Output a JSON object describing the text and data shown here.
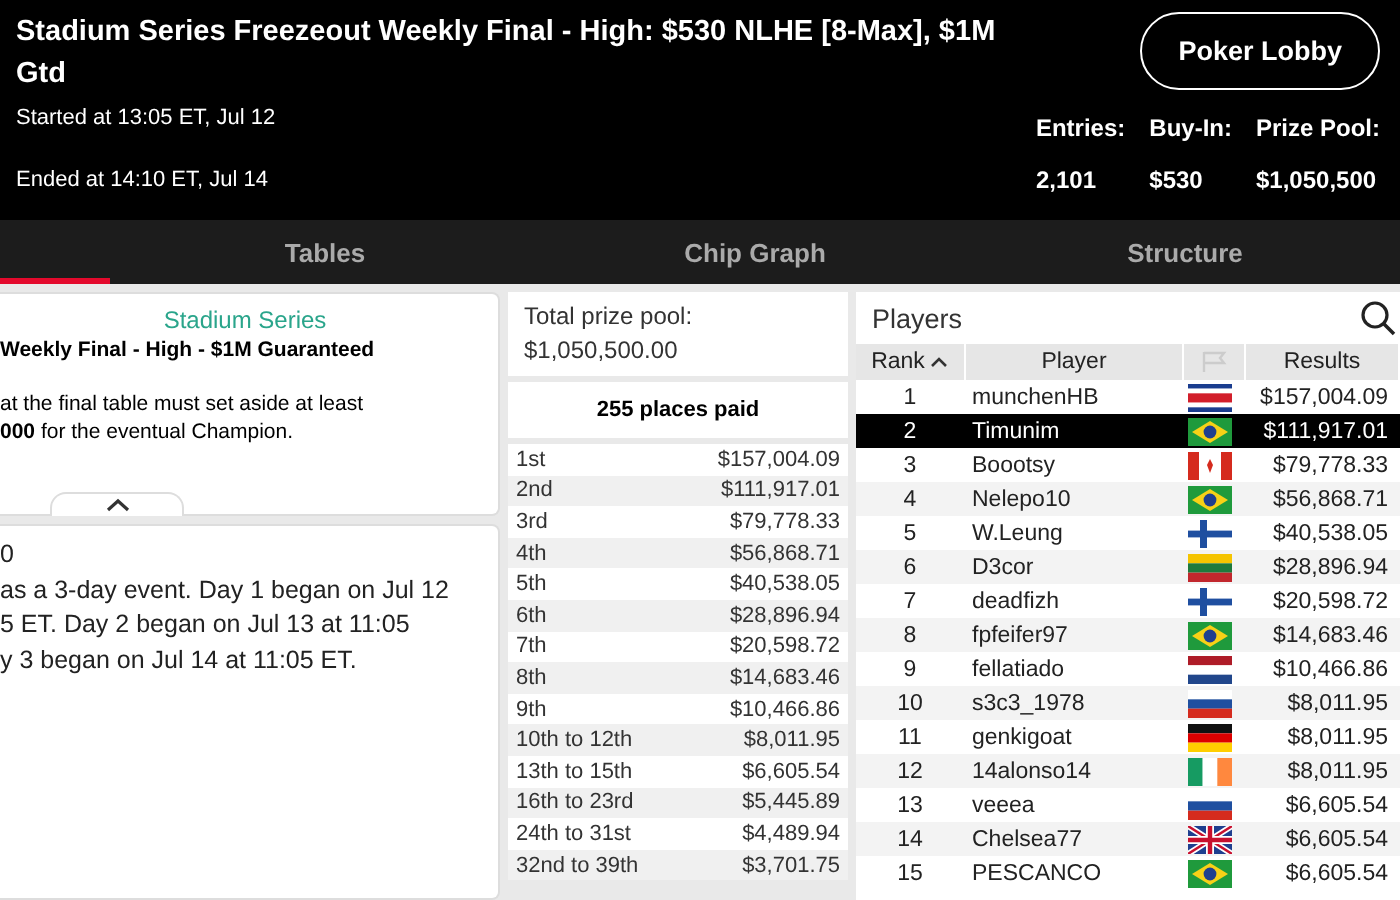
{
  "header": {
    "title": "Stadium Series Freezeout Weekly Final - High: $530 NLHE [8-Max], $1M Gtd",
    "started": "Started at 13:05 ET, Jul 12",
    "ended": "Ended at 14:10 ET, Jul 14",
    "lobby_button": "Poker Lobby",
    "stats": [
      {
        "label": "Entries:",
        "value": "2,101"
      },
      {
        "label": "Buy-In:",
        "value": "$530"
      },
      {
        "label": "Prize Pool:",
        "value": "$1,050,500"
      }
    ]
  },
  "tabs": [
    {
      "selected": true
    },
    {
      "label": "Tables",
      "selected": false
    },
    {
      "label": "Chip Graph",
      "selected": false
    },
    {
      "label": "Structure",
      "selected": false
    }
  ],
  "info_card": {
    "brand": "Stadium Series",
    "subtitle": "Weekly Final - High - $1M Guaranteed",
    "text": "at the final table must set aside at least\n**000** for the eventual Champion."
  },
  "details_card": {
    "lines": [
      "0",
      "as a 3-day event. Day 1 began on Jul 12",
      "5 ET. Day 2 began on Jul 13 at 11:05",
      "y 3 began on Jul 14 at 11:05 ET."
    ]
  },
  "prizes": {
    "total_label": "Total prize pool:",
    "total": "$1,050,500.00",
    "places_paid": "255 places paid",
    "rows": [
      {
        "place": "1st",
        "amount": "$157,004.09"
      },
      {
        "place": "2nd",
        "amount": "$111,917.01"
      },
      {
        "place": "3rd",
        "amount": "$79,778.33"
      },
      {
        "place": "4th",
        "amount": "$56,868.71"
      },
      {
        "place": "5th",
        "amount": "$40,538.05"
      },
      {
        "place": "6th",
        "amount": "$28,896.94"
      },
      {
        "place": "7th",
        "amount": "$20,598.72"
      },
      {
        "place": "8th",
        "amount": "$14,683.46"
      },
      {
        "place": "9th",
        "amount": "$10,466.86"
      },
      {
        "place": "10th to 12th",
        "amount": "$8,011.95"
      },
      {
        "place": "13th to 15th",
        "amount": "$6,605.54"
      },
      {
        "place": "16th to 23rd",
        "amount": "$5,445.89"
      },
      {
        "place": "24th to 31st",
        "amount": "$4,489.94"
      },
      {
        "place": "32nd to 39th",
        "amount": "$3,701.75"
      }
    ]
  },
  "players": {
    "title": "Players",
    "columns": [
      "Rank",
      "Player",
      "Results"
    ],
    "rows": [
      {
        "rank": "1",
        "name": "munchenHB",
        "kind": "cr",
        "result": "$157,004.09",
        "selected": false
      },
      {
        "rank": "2",
        "name": "Timunim",
        "kind": "br",
        "result": "$111,917.01",
        "selected": true
      },
      {
        "rank": "3",
        "name": "Boootsy",
        "kind": "ca",
        "result": "$79,778.33",
        "selected": false
      },
      {
        "rank": "4",
        "name": "Nelepo10",
        "kind": "br",
        "result": "$56,868.71",
        "selected": false
      },
      {
        "rank": "5",
        "name": "W.Leung",
        "kind": "fi",
        "result": "$40,538.05",
        "selected": false
      },
      {
        "rank": "6",
        "name": "D3cor",
        "kind": "lt",
        "result": "$28,896.94",
        "selected": false
      },
      {
        "rank": "7",
        "name": "deadfizh",
        "kind": "fi",
        "result": "$20,598.72",
        "selected": false
      },
      {
        "rank": "8",
        "name": "fpfeifer97",
        "kind": "br",
        "result": "$14,683.46",
        "selected": false
      },
      {
        "rank": "9",
        "name": "fellatiado",
        "kind": "nl",
        "result": "$10,466.86",
        "selected": false
      },
      {
        "rank": "10",
        "name": "s3c3_1978",
        "kind": "ru",
        "result": "$8,011.95",
        "selected": false
      },
      {
        "rank": "11",
        "name": "genkigoat",
        "kind": "de",
        "result": "$8,011.95",
        "selected": false
      },
      {
        "rank": "12",
        "name": "14alonso14",
        "kind": "ie",
        "result": "$8,011.95",
        "selected": false
      },
      {
        "rank": "13",
        "name": "veeea",
        "kind": "ru",
        "result": "$6,605.54",
        "selected": false
      },
      {
        "rank": "14",
        "name": "Chelsea77",
        "kind": "gb",
        "result": "$6,605.54",
        "selected": false
      },
      {
        "rank": "15",
        "name": "PESCANCO",
        "kind": "br",
        "result": "$6,605.54",
        "selected": false
      }
    ]
  }
}
